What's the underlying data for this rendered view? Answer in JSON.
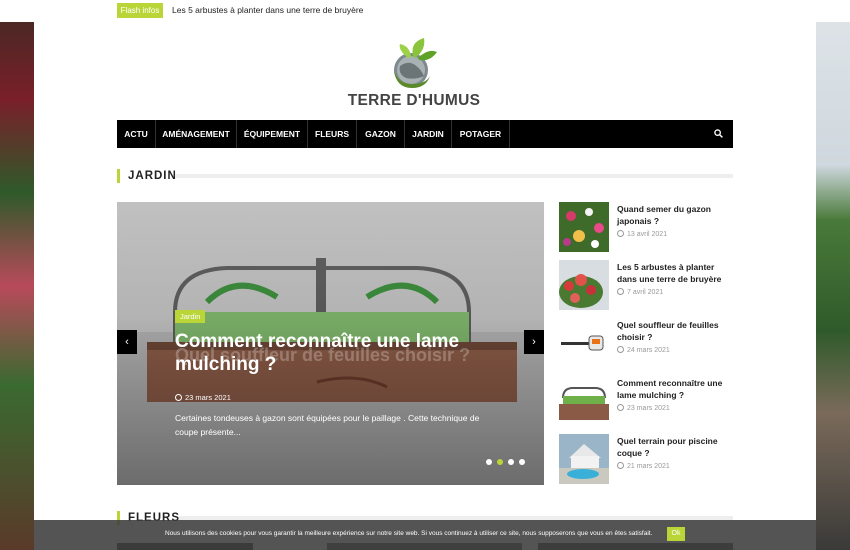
{
  "flash": {
    "badge": "Flash infos",
    "text": "Les 5 arbustes à planter dans une terre de bruyère"
  },
  "brand": {
    "name": "TERRE D'HUMUS"
  },
  "nav": {
    "items": [
      "ACTU",
      "AMÉNAGEMENT",
      "ÉQUIPEMENT",
      "FLEURS",
      "GAZON",
      "JARDIN",
      "POTAGER"
    ]
  },
  "sections": {
    "jardin": "JARDIN",
    "fleurs": "FLEURS"
  },
  "slider": {
    "category": "Jardin",
    "ghost_title": "Quel souffleur de feuilles choisir ?",
    "title": "Comment reconnaître une lame mulching ?",
    "date": "23 mars 2021",
    "excerpt": "Certaines tondeuses à gazon sont équipées pour le paillage . Cette technique de coupe présente...",
    "dots": 4,
    "active_dot": 1
  },
  "side_posts": [
    {
      "title": "Quand semer du gazon japonais ?",
      "date": "13 avril 2021",
      "thumb": "flowers"
    },
    {
      "title": "Les 5 arbustes à planter dans une terre de bruyère",
      "date": "7 avril 2021",
      "thumb": "shrub"
    },
    {
      "title": "Quel souffleur de feuilles choisir ?",
      "date": "24 mars 2021",
      "thumb": "blower"
    },
    {
      "title": "Comment reconnaître une lame mulching ?",
      "date": "23 mars 2021",
      "thumb": "mulching"
    },
    {
      "title": "Quel terrain pour piscine coque ?",
      "date": "21 mars 2021",
      "thumb": "pool"
    }
  ],
  "cookie": {
    "text": "Nous utilisons des cookies pour vous garantir la meilleure expérience sur notre site web. Si vous continuez à utiliser ce site, nous supposerons que vous en êtes satisfait.",
    "ok": "Ok"
  },
  "colors": {
    "accent": "#b9d538",
    "nav_bg": "#000000"
  }
}
